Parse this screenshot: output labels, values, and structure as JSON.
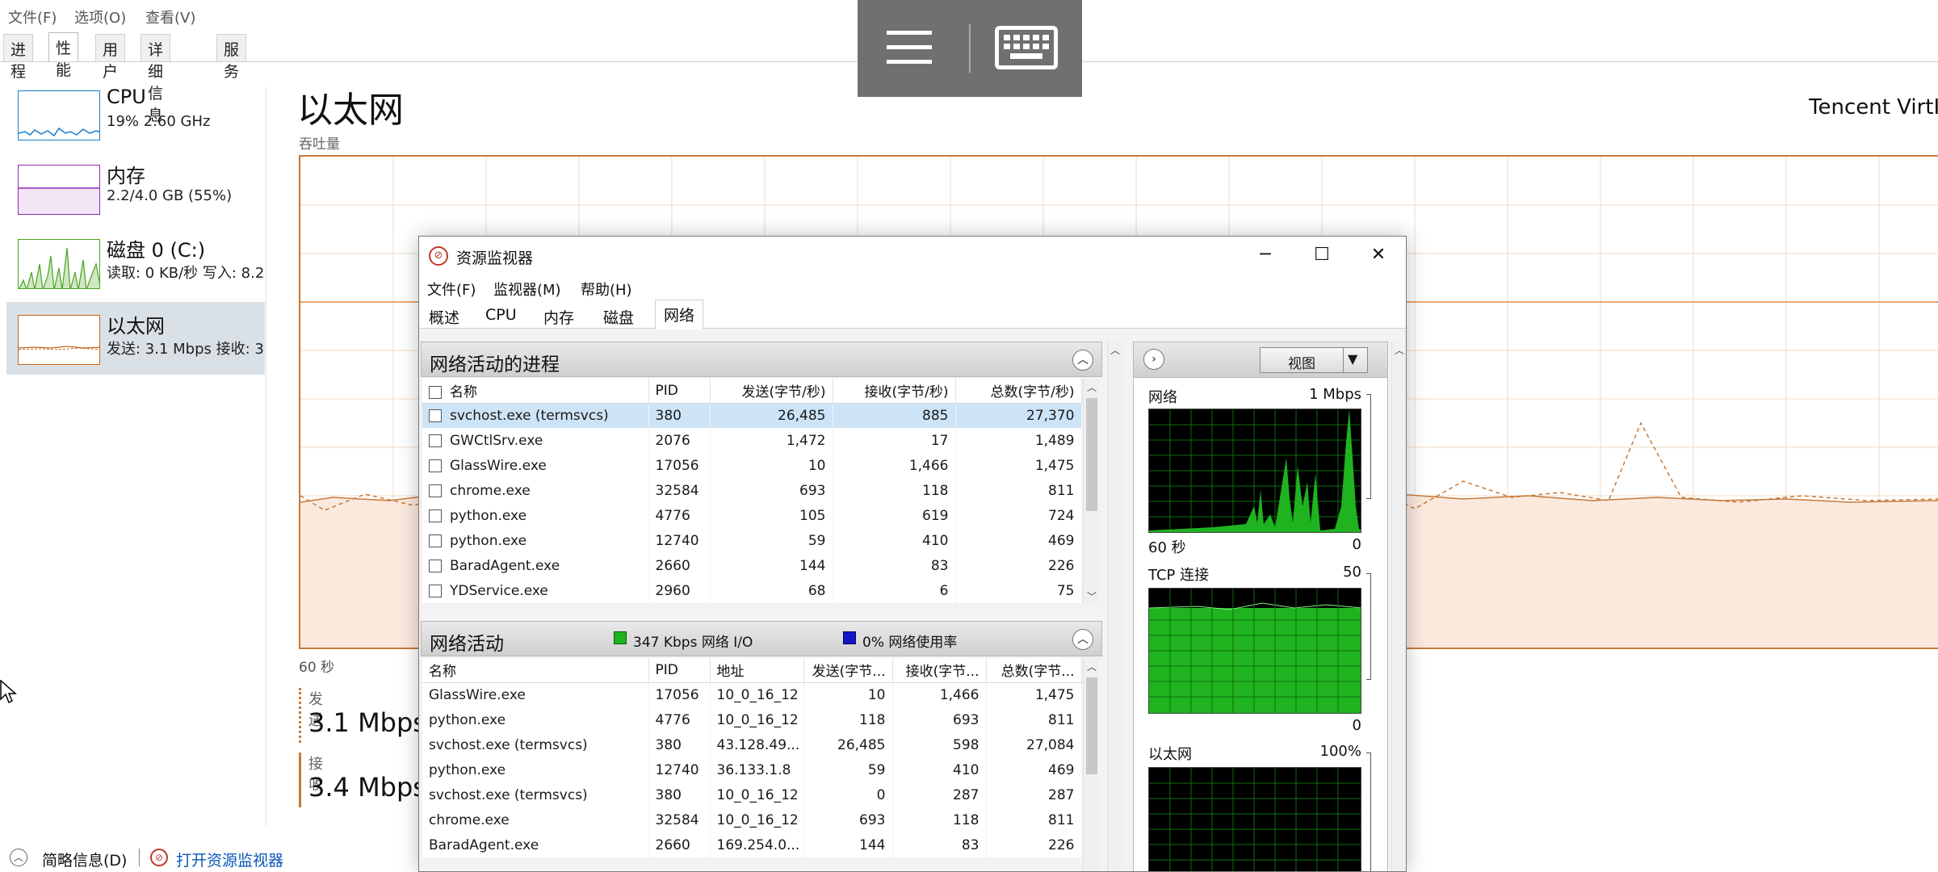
{
  "tm": {
    "menu": [
      "文件(F)",
      "选项(O)",
      "查看(V)"
    ],
    "tabs": [
      "进程",
      "性能",
      "用户",
      "详细信息",
      "服务"
    ],
    "side": [
      {
        "title": "CPU",
        "sub": "19% 2.60 GHz",
        "color": "#1a7ec8"
      },
      {
        "title": "内存",
        "sub": "2.2/4.0 GB (55%)",
        "color": "#8b29b0"
      },
      {
        "title": "磁盘 0 (C:)",
        "sub": "读取: 0 KB/秒 写入: 8.2",
        "color": "#4ca321"
      },
      {
        "title": "以太网",
        "sub": "发送: 3.1 Mbps 接收: 3",
        "color": "#c4661f"
      }
    ],
    "eth_title": "以太网",
    "eth_adapter": "Tencent VirtIO",
    "throughput": "吞吐量",
    "sixty_sec": "60 秒",
    "send_label": "发送",
    "send_value": "3.1 Mbps",
    "recv_label": "接收",
    "recv_value": "3.4 Mbps",
    "footer_less": "简略信息(D)",
    "footer_open": "打开资源监视器"
  },
  "rm": {
    "title": "资源监视器",
    "menu": [
      "文件(F)",
      "监视器(M)",
      "帮助(H)"
    ],
    "tabs": [
      "概述",
      "CPU",
      "内存",
      "磁盘",
      "网络"
    ],
    "proc_panel": {
      "title": "网络活动的进程",
      "columns": [
        "名称",
        "PID",
        "发送(字节/秒)",
        "接收(字节/秒)",
        "总数(字节/秒)"
      ],
      "rows": [
        [
          "svchost.exe (termsvcs)",
          "380",
          "26,485",
          "885",
          "27,370"
        ],
        [
          "GWCtlSrv.exe",
          "2076",
          "1,472",
          "17",
          "1,489"
        ],
        [
          "GlassWire.exe",
          "17056",
          "10",
          "1,466",
          "1,475"
        ],
        [
          "chrome.exe",
          "32584",
          "693",
          "118",
          "811"
        ],
        [
          "python.exe",
          "4776",
          "105",
          "619",
          "724"
        ],
        [
          "python.exe",
          "12740",
          "59",
          "410",
          "469"
        ],
        [
          "BaradAgent.exe",
          "2660",
          "144",
          "83",
          "226"
        ],
        [
          "YDService.exe",
          "2960",
          "68",
          "6",
          "75"
        ]
      ]
    },
    "net_panel": {
      "title": "网络活动",
      "io": "347 Kbps 网络 I/O",
      "usage": "0% 网络使用率",
      "columns": [
        "名称",
        "PID",
        "地址",
        "发送(字节...",
        "接收(字节...",
        "总数(字节..."
      ],
      "rows": [
        [
          "GlassWire.exe",
          "17056",
          "10_0_16_12",
          "10",
          "1,466",
          "1,475"
        ],
        [
          "python.exe",
          "4776",
          "10_0_16_12",
          "118",
          "693",
          "811"
        ],
        [
          "svchost.exe (termsvcs)",
          "380",
          "43.128.49...",
          "26,485",
          "598",
          "27,084"
        ],
        [
          "python.exe",
          "12740",
          "36.133.1.8",
          "59",
          "410",
          "469"
        ],
        [
          "svchost.exe (termsvcs)",
          "380",
          "10_0_16_12",
          "0",
          "287",
          "287"
        ],
        [
          "chrome.exe",
          "32584",
          "10_0_16_12",
          "693",
          "118",
          "811"
        ],
        [
          "BaradAgent.exe",
          "2660",
          "169.254.0...",
          "144",
          "83",
          "226"
        ]
      ]
    },
    "right": {
      "view_label": "视图",
      "g1_title": "网络",
      "g1_max": "1 Mbps",
      "g1_time": "60 秒",
      "g1_min": "0",
      "g2_title": "TCP 连接",
      "g2_max": "50",
      "g2_min": "0",
      "g3_title": "以太网",
      "g3_max": "100%"
    }
  },
  "colors": {
    "eth": "#c4661f",
    "selection": "#cde4f7",
    "graph_green": "#22c122"
  }
}
